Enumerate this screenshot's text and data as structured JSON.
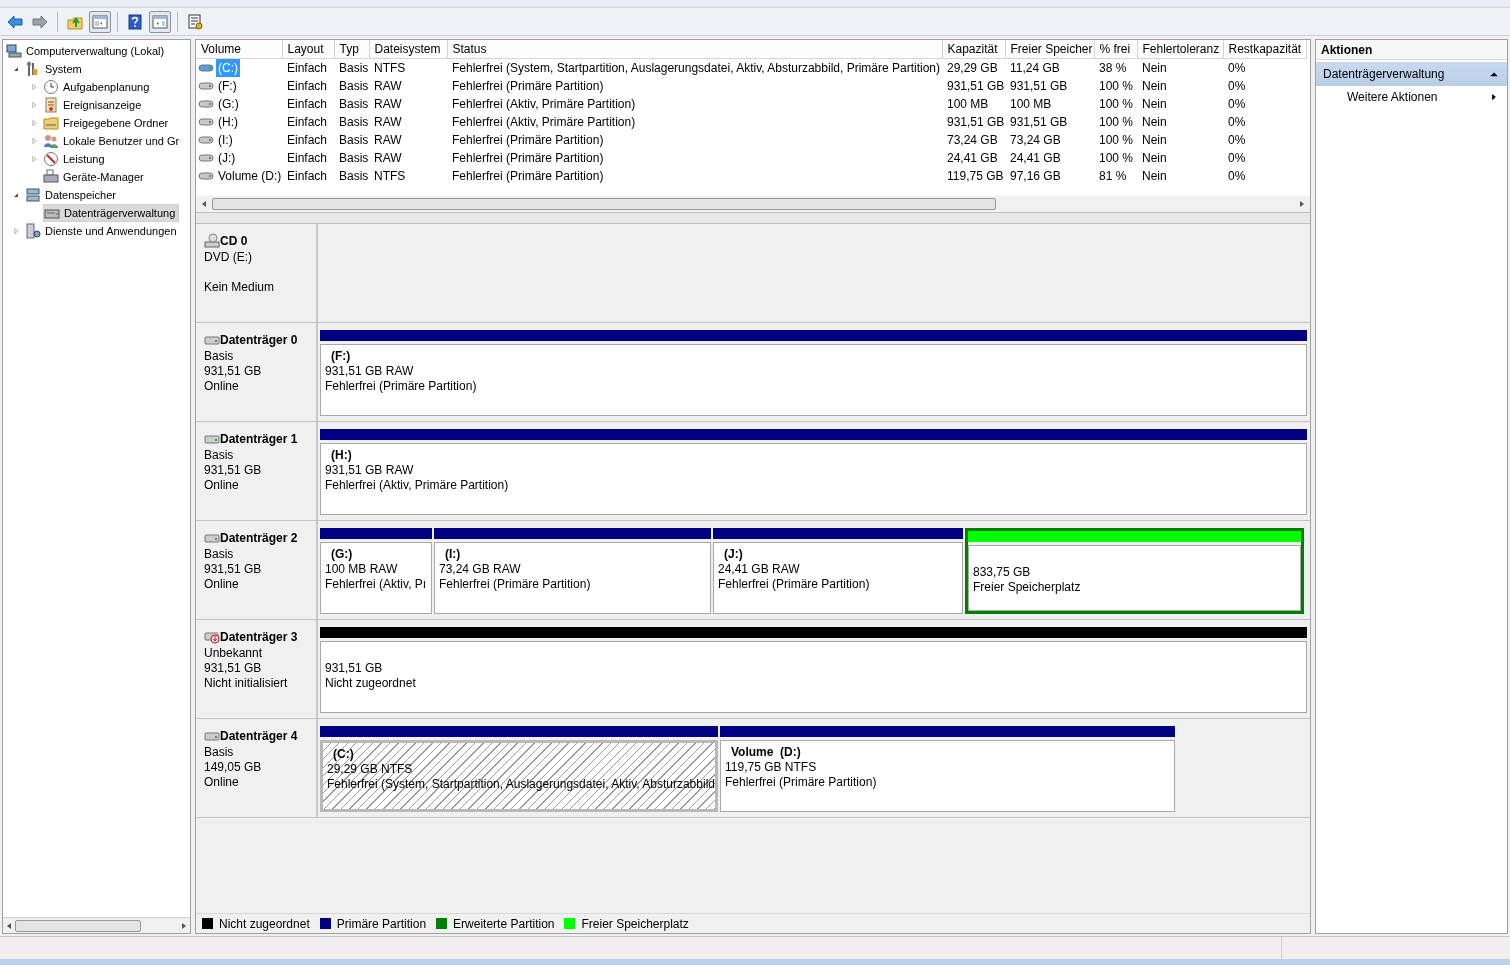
{
  "toolbar": [
    {
      "kind": "back"
    },
    {
      "kind": "forward"
    },
    {
      "kind": "sep"
    },
    {
      "kind": "up"
    },
    {
      "kind": "tree"
    },
    {
      "kind": "sep"
    },
    {
      "kind": "help"
    },
    {
      "kind": "pane"
    },
    {
      "kind": "sep"
    },
    {
      "kind": "props"
    }
  ],
  "tree": [
    {
      "label": "Computerverwaltung (Lokal)",
      "selected": false,
      "children": [
        {
          "label": "System",
          "expanded": true,
          "selected": false,
          "children": [
            {
              "label": "Aufgabenplanung",
              "expanded": false,
              "selected": false
            },
            {
              "label": "Ereignisanzeige",
              "expanded": false,
              "selected": false
            },
            {
              "label": "Freigegebene Ordner",
              "expanded": false,
              "selected": false
            },
            {
              "label": "Lokale Benutzer und Gr",
              "expanded": false,
              "selected": false
            },
            {
              "label": "Leistung",
              "expanded": false,
              "selected": false
            },
            {
              "label": "Geräte-Manager",
              "selected": false
            }
          ]
        },
        {
          "label": "Datenspeicher",
          "expanded": true,
          "selected": false,
          "children": [
            {
              "label": "Datenträgerverwaltung",
              "selected": true
            }
          ]
        },
        {
          "label": "Dienste und Anwendungen",
          "expanded": false,
          "selected": false
        }
      ]
    }
  ],
  "table": {
    "columns": [
      "Volume",
      "Layout",
      "Typ",
      "Dateisystem",
      "Status",
      "Kapazität",
      "Freier Speicher",
      "% frei",
      "Fehlertoleranz",
      "Restkapazität"
    ],
    "rows": [
      {
        "selected": true,
        "cells": [
          "(C:)",
          "Einfach",
          "Basis",
          "NTFS",
          "Fehlerfrei (System, Startpartition, Auslagerungsdatei, Aktiv, Absturzabbild, Primäre Partition)",
          "29,29 GB",
          "11,24 GB",
          "38 %",
          "Nein",
          "0%"
        ]
      },
      {
        "selected": false,
        "cells": [
          "(F:)",
          "Einfach",
          "Basis",
          "RAW",
          "Fehlerfrei (Primäre Partition)",
          "931,51 GB",
          "931,51 GB",
          "100 %",
          "Nein",
          "0%"
        ]
      },
      {
        "selected": false,
        "cells": [
          "(G:)",
          "Einfach",
          "Basis",
          "RAW",
          "Fehlerfrei (Aktiv, Primäre Partition)",
          "100 MB",
          "100 MB",
          "100 %",
          "Nein",
          "0%"
        ]
      },
      {
        "selected": false,
        "cells": [
          "(H:)",
          "Einfach",
          "Basis",
          "RAW",
          "Fehlerfrei (Aktiv, Primäre Partition)",
          "931,51 GB",
          "931,51 GB",
          "100 %",
          "Nein",
          "0%"
        ]
      },
      {
        "selected": false,
        "cells": [
          "(I:)",
          "Einfach",
          "Basis",
          "RAW",
          "Fehlerfrei (Primäre Partition)",
          "73,24 GB",
          "73,24 GB",
          "100 %",
          "Nein",
          "0%"
        ]
      },
      {
        "selected": false,
        "cells": [
          "(J:)",
          "Einfach",
          "Basis",
          "RAW",
          "Fehlerfrei (Primäre Partition)",
          "24,41 GB",
          "24,41 GB",
          "100 %",
          "Nein",
          "0%"
        ]
      },
      {
        "selected": false,
        "cells": [
          "Volume (D:)",
          "Einfach",
          "Basis",
          "NTFS",
          "Fehlerfrei (Primäre Partition)",
          "119,75 GB",
          "97,16 GB",
          "81 %",
          "Nein",
          "0%"
        ]
      }
    ]
  },
  "disks": [
    {
      "kind": "cd",
      "name": "CD 0",
      "lines": [
        "DVD (E:)"
      ],
      "status": "Kein Medium"
    },
    {
      "kind": "disk",
      "name": "Datenträger 0",
      "lines": [
        "Basis",
        "931,51 GB"
      ],
      "status": "Online",
      "partitions": [
        {
          "kind": "primary",
          "selected": false,
          "name": "(F:)",
          "size": "931,51 GB RAW",
          "status": "Fehlerfrei (Primäre Partition)"
        }
      ]
    },
    {
      "kind": "disk",
      "name": "Datenträger 1",
      "lines": [
        "Basis",
        "931,51 GB"
      ],
      "status": "Online",
      "partitions": [
        {
          "kind": "primary",
          "selected": false,
          "name": "(H:)",
          "size": "931,51 GB RAW",
          "status": "Fehlerfrei (Aktiv, Primäre Partition)"
        }
      ]
    },
    {
      "kind": "disk",
      "name": "Datenträger 2",
      "lines": [
        "Basis",
        "931,51 GB"
      ],
      "status": "Online",
      "partitions": [
        {
          "kind": "primary",
          "selected": false,
          "name": "(G:)",
          "size": "100 MB RAW",
          "status": "Fehlerfrei (Aktiv, Pı"
        },
        {
          "kind": "primary",
          "selected": false,
          "name": "(I:)",
          "size": "73,24 GB RAW",
          "status": "Fehlerfrei (Primäre Partition)"
        },
        {
          "kind": "primary",
          "selected": false,
          "name": "(J:)",
          "size": "24,41 GB RAW",
          "status": "Fehlerfrei (Primäre Partition)"
        },
        {
          "kind": "free",
          "selected": false,
          "size": "833,75 GB",
          "status": "Freier Speicherplatz"
        }
      ]
    },
    {
      "kind": "disk-error",
      "name": "Datenträger 3",
      "lines": [
        "Unbekannt",
        "931,51 GB"
      ],
      "status": "Nicht initialisiert",
      "partitions": [
        {
          "kind": "unallocated",
          "selected": false,
          "size": "931,51 GB",
          "status": "Nicht zugeordnet"
        }
      ]
    },
    {
      "kind": "disk",
      "name": "Datenträger 4",
      "lines": [
        "Basis",
        "149,05 GB"
      ],
      "status": "Online",
      "partitions": [
        {
          "kind": "primary",
          "selected": true,
          "name": "(C:)",
          "size": "29,29 GB NTFS",
          "status": "Fehlerfrei (System, Startpartition, Auslagerungsdatei, Aktiv, Absturzabbild"
        },
        {
          "kind": "primary",
          "selected": false,
          "name": "Volume  (D:)",
          "size": "119,75 GB NTFS",
          "status": "Fehlerfrei (Primäre Partition)"
        }
      ]
    }
  ],
  "legend": [
    {
      "label": "Nicht zugeordnet",
      "color": "#000000"
    },
    {
      "label": "Primäre Partition",
      "color": "#000080"
    },
    {
      "label": "Erweiterte Partition",
      "color": "#008000"
    },
    {
      "label": "Freier Speicherplatz",
      "color": "#00ff00"
    }
  ],
  "actions": {
    "title": "Aktionen",
    "sections": [
      {
        "label": "Datenträgerverwaltung",
        "expanded": true,
        "items": [
          {
            "label": "Weitere Aktionen"
          }
        ]
      }
    ]
  }
}
